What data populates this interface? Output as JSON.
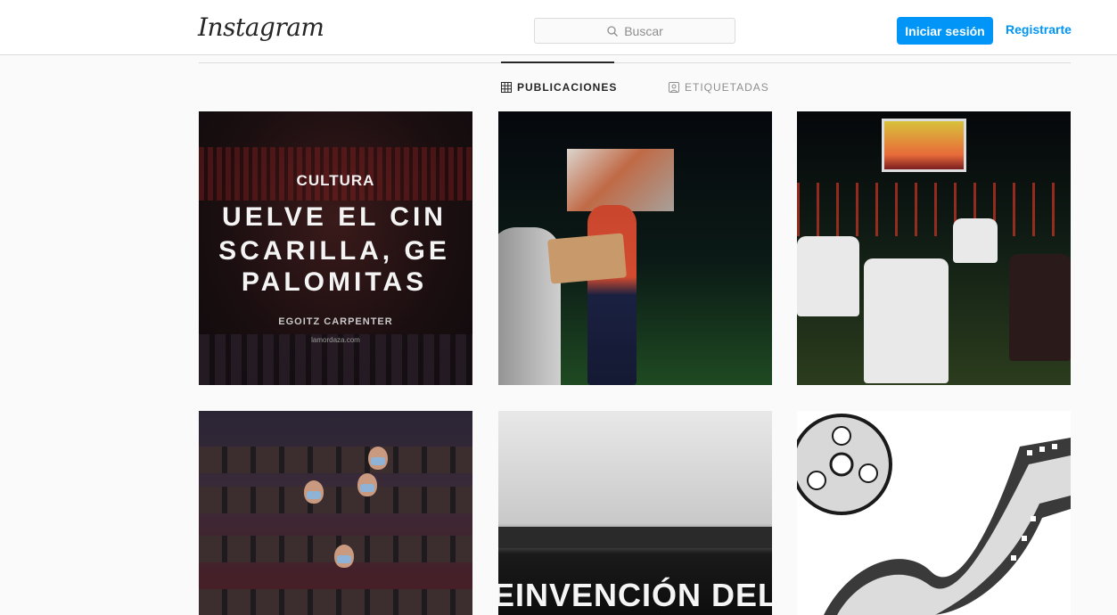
{
  "header": {
    "logo": "Instagram",
    "search_placeholder": "Buscar",
    "login_label": "Iniciar sesión",
    "register_label": "Registrarte"
  },
  "tabs": [
    {
      "label": "PUBLICACIONES",
      "icon": "grid-icon",
      "active": true
    },
    {
      "label": "ETIQUETADAS",
      "icon": "tagged-icon",
      "active": false
    }
  ],
  "posts": {
    "p1": {
      "kicker": "CULTURA",
      "line1": "UELVE EL CIN",
      "line2": "SCARILLA, GE",
      "line3": "PALOMITAS",
      "author": "EGOITZ CARPENTER",
      "site": "lamordaza.com"
    },
    "p5": {
      "text": "EINVENCIÓN DEL C"
    }
  },
  "colors": {
    "accent": "#0095f6",
    "text_primary": "#262626",
    "text_secondary": "#8e8e8e",
    "border": "#dbdbdb",
    "background": "#fafafa"
  }
}
